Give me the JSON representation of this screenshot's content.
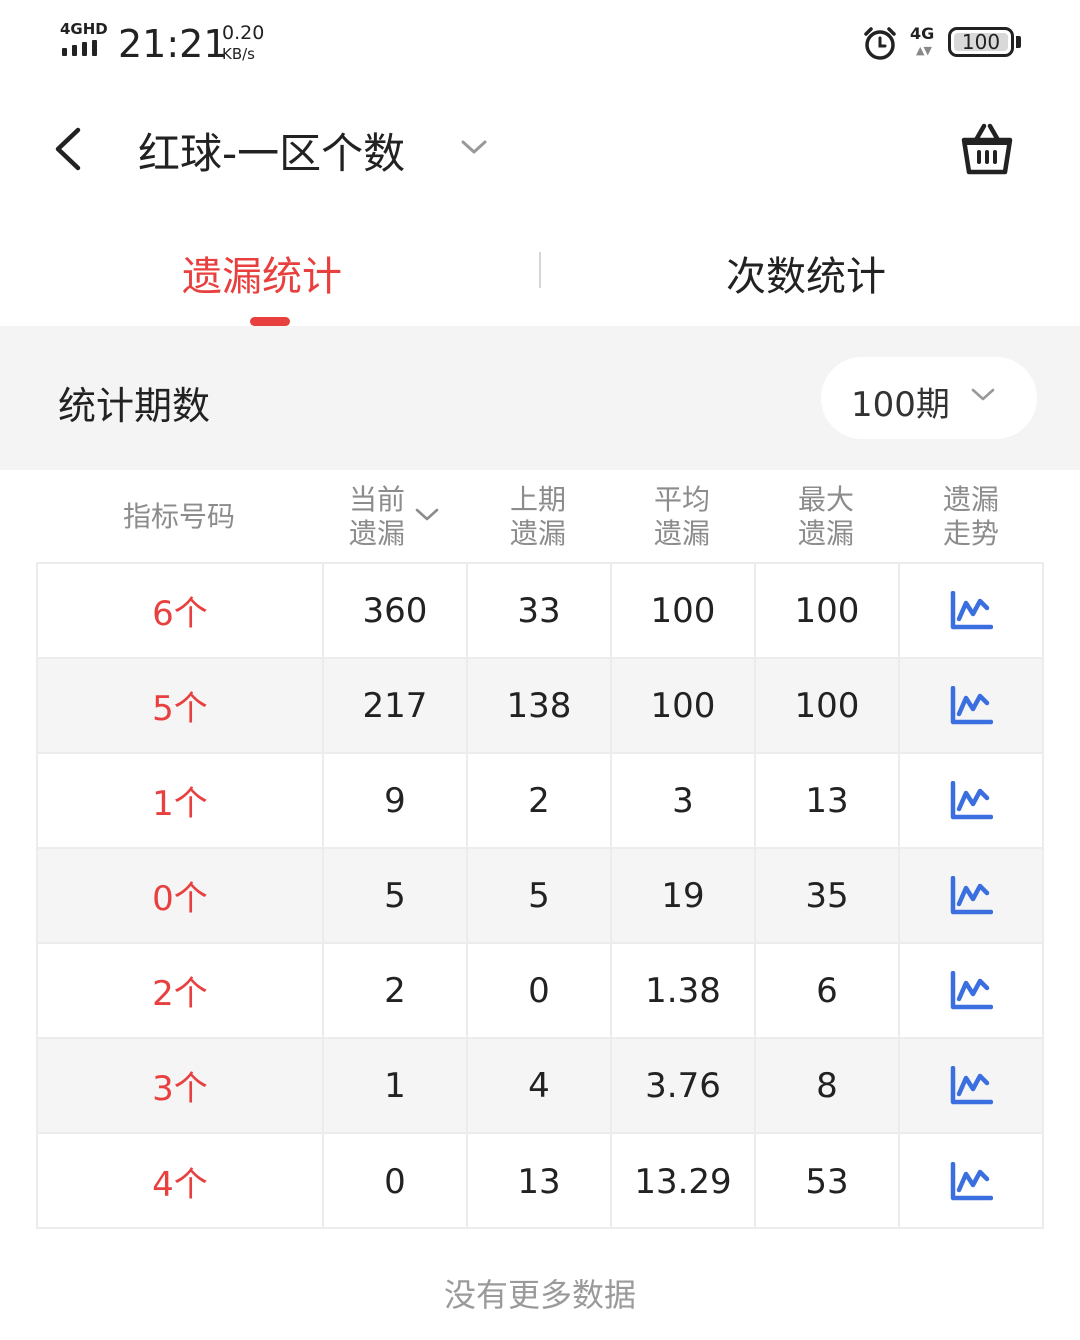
{
  "status_bar": {
    "network_label": "4GHD",
    "time": "21:21",
    "speed_value": "0.20",
    "speed_unit": "KB/s",
    "network_right": "4G",
    "battery": "100"
  },
  "header": {
    "title": "红球-一区个数"
  },
  "tabs": [
    {
      "label": "遗漏统计",
      "active": true
    },
    {
      "label": "次数统计",
      "active": false
    }
  ],
  "period": {
    "label": "统计期数",
    "selected": "100期"
  },
  "table": {
    "headers": [
      {
        "line1": "指标号码",
        "line2": ""
      },
      {
        "line1": "当前",
        "line2": "遗漏"
      },
      {
        "line1": "上期",
        "line2": "遗漏"
      },
      {
        "line1": "平均",
        "line2": "遗漏"
      },
      {
        "line1": "最大",
        "line2": "遗漏"
      },
      {
        "line1": "遗漏",
        "line2": "走势"
      }
    ],
    "rows": [
      {
        "code": "6个",
        "current": "360",
        "previous": "33",
        "average": "100",
        "max": "100"
      },
      {
        "code": "5个",
        "current": "217",
        "previous": "138",
        "average": "100",
        "max": "100"
      },
      {
        "code": "1个",
        "current": "9",
        "previous": "2",
        "average": "3",
        "max": "13"
      },
      {
        "code": "0个",
        "current": "5",
        "previous": "5",
        "average": "19",
        "max": "35"
      },
      {
        "code": "2个",
        "current": "2",
        "previous": "0",
        "average": "1.38",
        "max": "6"
      },
      {
        "code": "3个",
        "current": "1",
        "previous": "4",
        "average": "3.76",
        "max": "8"
      },
      {
        "code": "4个",
        "current": "0",
        "previous": "13",
        "average": "13.29",
        "max": "53"
      }
    ]
  },
  "footer": {
    "text": "没有更多数据"
  },
  "colors": {
    "accent": "#e8403f",
    "trend_icon": "#3b6fe0"
  },
  "icons": {
    "back": "chevron-left-icon",
    "title_dropdown": "chevron-down-icon",
    "basket": "basket-icon",
    "alarm": "alarm-clock-icon",
    "trend": "line-chart-icon"
  }
}
